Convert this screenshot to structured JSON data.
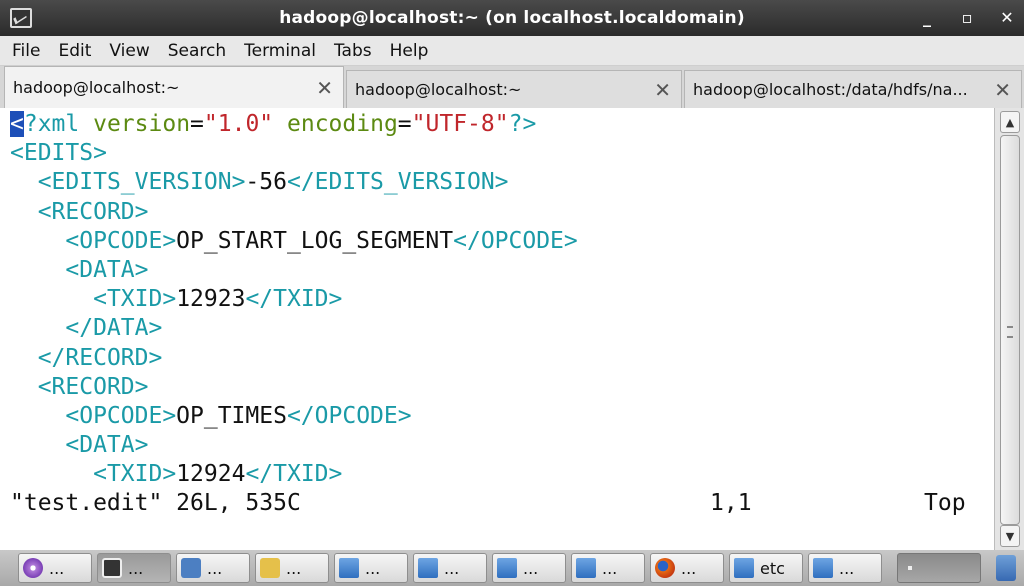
{
  "window": {
    "title": "hadoop@localhost:~ (on localhost.localdomain)",
    "buttons": {
      "minimize": "_",
      "maximize": "▫",
      "close": "✕"
    }
  },
  "menu": {
    "items": [
      "File",
      "Edit",
      "View",
      "Search",
      "Terminal",
      "Tabs",
      "Help"
    ]
  },
  "tabs": [
    {
      "label": "hadoop@localhost:~",
      "active": true
    },
    {
      "label": "hadoop@localhost:~",
      "active": false
    },
    {
      "label": "hadoop@localhost:/data/hdfs/na...",
      "active": false
    }
  ],
  "terminal": {
    "lines": [
      "<?xml version=\"1.0\" encoding=\"UTF-8\"?>",
      "<EDITS>",
      "  <EDITS_VERSION>-56</EDITS_VERSION>",
      "  <RECORD>",
      "    <OPCODE>OP_START_LOG_SEGMENT</OPCODE>",
      "    <DATA>",
      "      <TXID>12923</TXID>",
      "    </DATA>",
      "  </RECORD>",
      "  <RECORD>",
      "    <OPCODE>OP_TIMES</OPCODE>",
      "    <DATA>",
      "      <TXID>12924</TXID>"
    ],
    "status": {
      "file": "\"test.edit\" 26L, 535C",
      "position": "1,1",
      "scroll": "Top"
    }
  },
  "taskbar": {
    "items": [
      {
        "icon": "disc-icon",
        "label": "..."
      },
      {
        "icon": "terminal-icon",
        "label": "...",
        "active": true
      },
      {
        "icon": "network-icon",
        "label": "..."
      },
      {
        "icon": "editor-icon",
        "label": "..."
      },
      {
        "icon": "folder-icon",
        "label": "..."
      },
      {
        "icon": "folder-icon",
        "label": "..."
      },
      {
        "icon": "folder-icon",
        "label": "..."
      },
      {
        "icon": "folder-icon",
        "label": "..."
      },
      {
        "icon": "firefox-icon",
        "label": "..."
      },
      {
        "icon": "folder-icon",
        "label": "etc"
      },
      {
        "icon": "folder-icon",
        "label": "..."
      }
    ]
  }
}
